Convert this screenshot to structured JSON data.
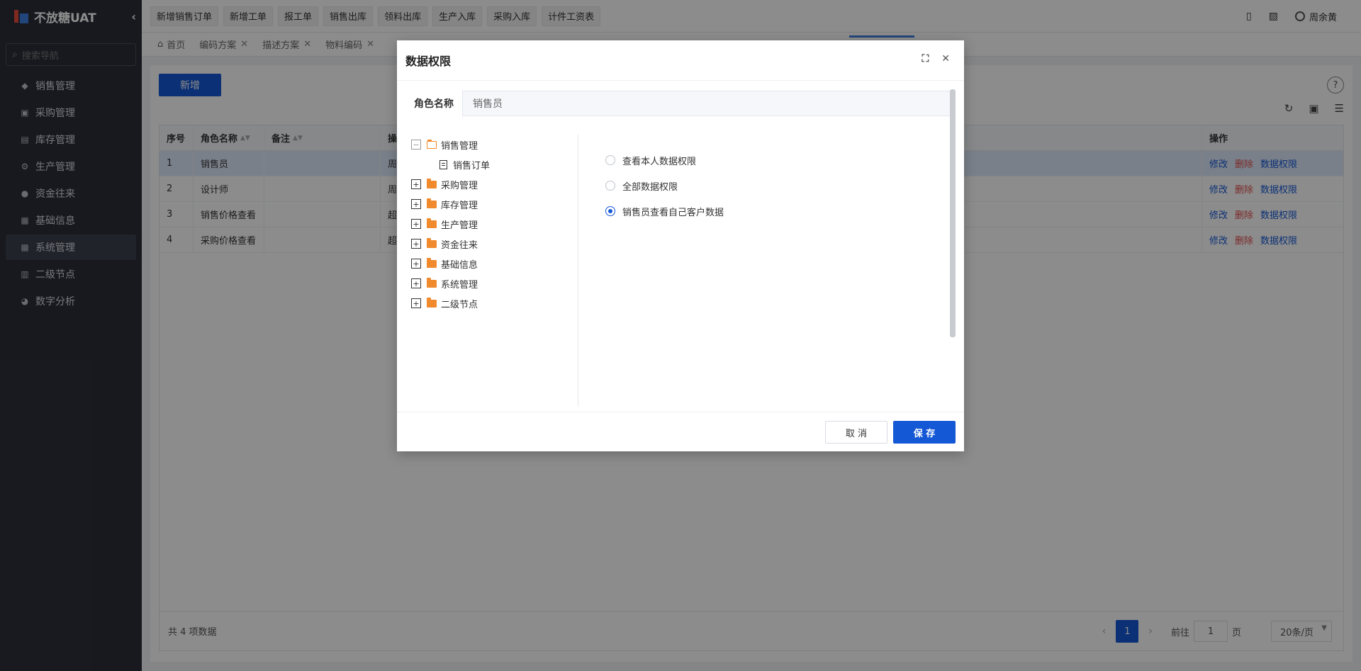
{
  "app": {
    "title": "不放糖UAT",
    "collapse_icon": "chevron-left-icon"
  },
  "sidebar": {
    "search_placeholder": "搜索导航",
    "items": [
      {
        "label": "销售管理",
        "icon": "tag-icon"
      },
      {
        "label": "采购管理",
        "icon": "cart-icon"
      },
      {
        "label": "库存管理",
        "icon": "warehouse-icon"
      },
      {
        "label": "生产管理",
        "icon": "factory-icon"
      },
      {
        "label": "资金往来",
        "icon": "coin-icon"
      },
      {
        "label": "基础信息",
        "icon": "grid-icon"
      },
      {
        "label": "系统管理",
        "icon": "apps-icon",
        "active": true
      },
      {
        "label": "二级节点",
        "icon": "list-icon"
      },
      {
        "label": "数字分析",
        "icon": "pie-icon"
      }
    ]
  },
  "topbar": {
    "quick_buttons": [
      "新增销售订单",
      "新增工单",
      "报工单",
      "销售出库",
      "领料出库",
      "生产入库",
      "采购入库",
      "计件工资表"
    ],
    "user_name": "周余黄"
  },
  "tabs": [
    {
      "label": "首页",
      "closable": false
    },
    {
      "label": "编码方案",
      "closable": true
    },
    {
      "label": "描述方案",
      "closable": true
    },
    {
      "label": "物料编码",
      "closable": true
    }
  ],
  "page": {
    "add_button": "新增",
    "columns": {
      "index": "序号",
      "name": "角色名称",
      "note": "备注",
      "op": "操",
      "actions": "操作"
    },
    "rows": [
      {
        "index": "1",
        "name": "销售员",
        "note": "",
        "op": "周",
        "selected": true
      },
      {
        "index": "2",
        "name": "设计师",
        "note": "",
        "op": "周"
      },
      {
        "index": "3",
        "name": "销售价格查看",
        "note": "",
        "op": "超"
      },
      {
        "index": "4",
        "name": "采购价格查看",
        "note": "",
        "op": "超"
      }
    ],
    "actions": {
      "edit": "修改",
      "delete": "删除",
      "perm": "数据权限"
    },
    "total_text": "共 4 项数据",
    "pager": {
      "current": "1",
      "goto_label": "前往",
      "goto_value": "1",
      "page_unit": "页",
      "page_size": "20条/页"
    }
  },
  "modal": {
    "title": "数据权限",
    "role_label": "角色名称",
    "role_value": "销售员",
    "tree": [
      {
        "label": "销售管理",
        "expanded": true,
        "children": [
          "销售订单"
        ]
      },
      {
        "label": "采购管理"
      },
      {
        "label": "库存管理"
      },
      {
        "label": "生产管理"
      },
      {
        "label": "资金往来"
      },
      {
        "label": "基础信息"
      },
      {
        "label": "系统管理"
      },
      {
        "label": "二级节点"
      }
    ],
    "options": [
      {
        "label": "查看本人数据权限",
        "checked": false
      },
      {
        "label": "全部数据权限",
        "checked": false
      },
      {
        "label": "销售员查看自己客户数据",
        "checked": true
      }
    ],
    "cancel_label": "取 消",
    "save_label": "保 存"
  },
  "colors": {
    "primary": "#1458d6",
    "danger": "#e04b4b",
    "sidebar": "#2b2f3a",
    "folder": "#f08a2c"
  }
}
